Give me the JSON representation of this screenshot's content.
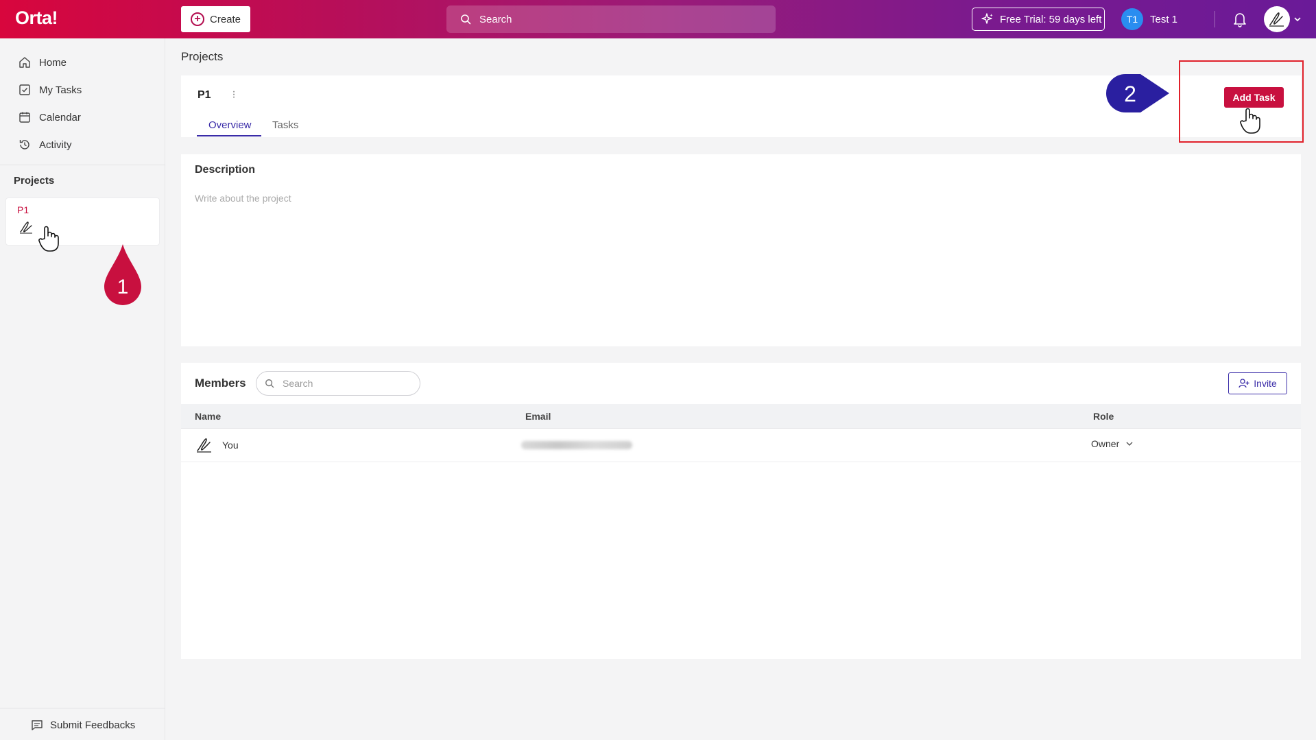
{
  "app": {
    "logo": "Orta!"
  },
  "topbar": {
    "create_label": "Create",
    "search_placeholder": "Search",
    "trial_label": "Free Trial: 59 days left",
    "user_initials": "T1",
    "user_name": "Test 1"
  },
  "sidebar": {
    "items": [
      {
        "label": "Home",
        "icon": "home-icon"
      },
      {
        "label": "My Tasks",
        "icon": "checkbox-icon"
      },
      {
        "label": "Calendar",
        "icon": "calendar-icon"
      },
      {
        "label": "Activity",
        "icon": "history-icon"
      }
    ],
    "projects_heading": "Projects",
    "project_card_name": "P1",
    "feedback_label": "Submit Feedbacks"
  },
  "main": {
    "breadcrumb": "Projects",
    "project_title": "P1",
    "tabs": [
      {
        "label": "Overview",
        "active": true
      },
      {
        "label": "Tasks",
        "active": false
      }
    ],
    "add_task_label": "Add Task",
    "description": {
      "title": "Description",
      "placeholder": "Write about the project"
    },
    "members": {
      "title": "Members",
      "search_placeholder": "Search",
      "invite_label": "Invite",
      "columns": [
        "Name",
        "Email",
        "Role"
      ],
      "rows": [
        {
          "name": "You",
          "email_redacted": true,
          "role": "Owner"
        }
      ]
    }
  },
  "annotations": {
    "step1": "1",
    "step2": "2"
  },
  "colors": {
    "brand_red": "#c8103f",
    "accent_purple": "#3a2ca8",
    "marker_red": "#c8103f",
    "marker_blue": "#2a1fa0",
    "highlight": "#e0202a"
  }
}
